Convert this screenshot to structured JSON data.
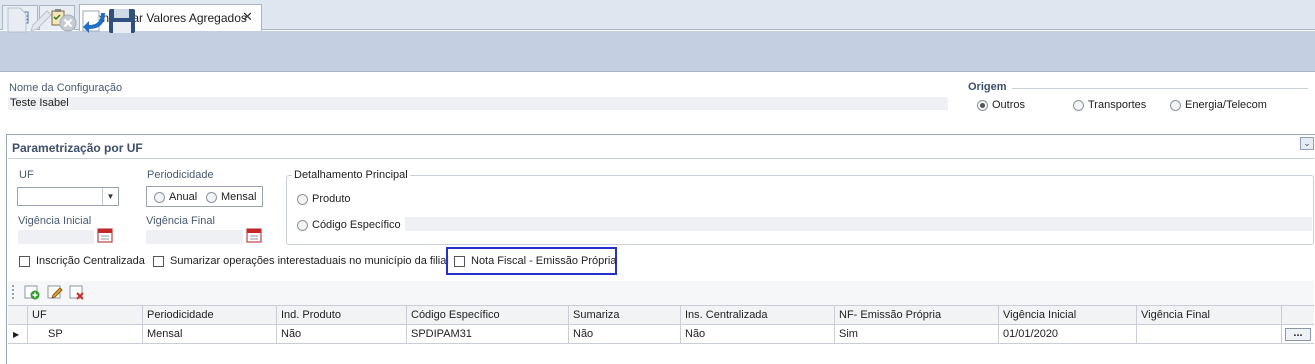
{
  "tabs": {
    "icon_tab_1": "grid-icon",
    "icon_tab_2": "checklist-icon",
    "active_label": "Configurar Valores Agregados",
    "close_glyph": "✕"
  },
  "toolbar": {
    "buttons": [
      "new-icon",
      "edit-icon",
      "cancel-icon",
      "undo-icon",
      "save-icon"
    ]
  },
  "config": {
    "name_label": "Nome da Configuração",
    "name_value": "Teste Isabel"
  },
  "origem": {
    "label": "Origem",
    "options": [
      "Outros",
      "Transportes",
      "Energia/Telecom"
    ],
    "selected": "Outros"
  },
  "param": {
    "title": "Parametrização por UF",
    "uf_label": "UF",
    "uf_value": "",
    "periodicidade_label": "Periodicidade",
    "periodicidade_options": [
      "Anual",
      "Mensal"
    ],
    "vig_inicial_label": "Vigência Inicial",
    "vig_final_label": "Vigência Final",
    "detalhamento_label": "Detalhamento Principal",
    "produto_label": "Produto",
    "codigo_label": "Código Específico",
    "chk_inscricao": "Inscrição Centralizada",
    "chk_sumarizar": "Sumarizar operações interestaduais no município da filial",
    "chk_nota_fiscal": "Nota Fiscal - Emissão Própria"
  },
  "grid": {
    "toolbar_icons": [
      "add-row-icon",
      "edit-row-icon",
      "delete-row-icon"
    ],
    "columns": [
      "UF",
      "Periodicidade",
      "Ind. Produto",
      "Código Específico",
      "Sumariza",
      "Ins. Centralizada",
      "NF- Emissão Própria",
      "Vigência Inicial",
      "Vigência Final"
    ],
    "rows": [
      {
        "uf": "SP",
        "periodicidade": "Mensal",
        "ind_produto": "Não",
        "codigo": "SPDIPAM31",
        "sumariza": "Não",
        "ins_centralizada": "Não",
        "nf_emissao": "Sim",
        "vig_inicial": "01/01/2020",
        "vig_final": "",
        "ellipsis": "..."
      }
    ]
  },
  "colors": {
    "highlight_border": "#2432c9",
    "toolbar_bg": "#c4d0e1"
  }
}
